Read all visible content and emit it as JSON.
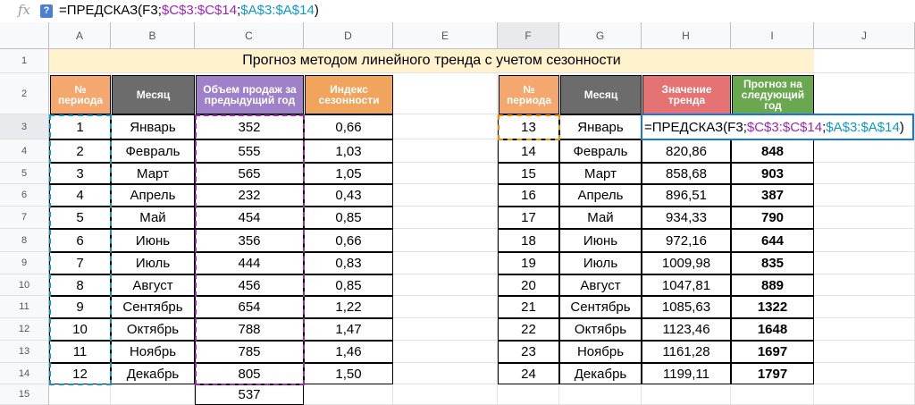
{
  "formula_bar": {
    "icon": "fx-icon",
    "help_icon": "help-icon",
    "help_label": "?",
    "formula": [
      {
        "t": "=ПРЕДСКАЗ(",
        "c": ""
      },
      {
        "t": "F3",
        "c": "f"
      },
      {
        "t": ";",
        "c": ""
      },
      {
        "t": "$C$3:$C$14",
        "c": "ca"
      },
      {
        "t": ";",
        "c": ""
      },
      {
        "t": "$A$3:$A$14",
        "c": "aa"
      },
      {
        "t": ")",
        "c": ""
      }
    ]
  },
  "columns": [
    "A",
    "B",
    "C",
    "D",
    "E",
    "F",
    "G",
    "H",
    "I",
    "J"
  ],
  "row_numbers": [
    "1",
    "2",
    "3",
    "4",
    "5",
    "6",
    "7",
    "8",
    "9",
    "10",
    "11",
    "12",
    "13",
    "14",
    "15"
  ],
  "title": "Прогноз методом линейного тренда с учетом сезонности",
  "left_headers": [
    {
      "text": "№ периода",
      "color": "#f5a86e"
    },
    {
      "text": "Месяц",
      "color": "#6c6c6c"
    },
    {
      "text": "Объем продаж за предыдущий год",
      "color": "#9e81c9"
    },
    {
      "text": "Индекс сезонности",
      "color": "#f0a45c"
    }
  ],
  "right_headers": [
    {
      "text": "№ периода",
      "color": "#f5a86e"
    },
    {
      "text": "Месяц",
      "color": "#6c6c6c"
    },
    {
      "text": "Значение тренда",
      "color": "#e57373"
    },
    {
      "text": "Прогноз на следующий год",
      "color": "#6aa84f"
    }
  ],
  "left_rows": [
    [
      "1",
      "Январь",
      "352",
      "0,66"
    ],
    [
      "2",
      "Февраль",
      "555",
      "1,03"
    ],
    [
      "3",
      "Март",
      "565",
      "1,05"
    ],
    [
      "4",
      "Апрель",
      "232",
      "0,43"
    ],
    [
      "5",
      "Май",
      "454",
      "0,85"
    ],
    [
      "6",
      "Июнь",
      "356",
      "0,66"
    ],
    [
      "7",
      "Июль",
      "444",
      "0,83"
    ],
    [
      "8",
      "Август",
      "456",
      "0,85"
    ],
    [
      "9",
      "Сентябрь",
      "654",
      "1,22"
    ],
    [
      "10",
      "Октябрь",
      "788",
      "1,47"
    ],
    [
      "11",
      "Ноябрь",
      "785",
      "1,46"
    ],
    [
      "12",
      "Декабрь",
      "805",
      "1,50"
    ]
  ],
  "total_c15": "537",
  "right_rows": [
    [
      "13",
      "Январь",
      "",
      ""
    ],
    [
      "14",
      "Февраль",
      "820,86",
      "848"
    ],
    [
      "15",
      "Март",
      "858,68",
      "903"
    ],
    [
      "16",
      "Апрель",
      "896,51",
      "387"
    ],
    [
      "17",
      "Май",
      "934,33",
      "790"
    ],
    [
      "18",
      "Июнь",
      "972,16",
      "644"
    ],
    [
      "19",
      "Июль",
      "1009,98",
      "835"
    ],
    [
      "20",
      "Август",
      "1047,81",
      "889"
    ],
    [
      "21",
      "Сентябрь",
      "1085,63",
      "1322"
    ],
    [
      "22",
      "Октябрь",
      "1123,46",
      "1648"
    ],
    [
      "23",
      "Ноябрь",
      "1161,28",
      "1697"
    ],
    [
      "24",
      "Декабрь",
      "1199,11",
      "1797"
    ]
  ],
  "colors": {
    "title_bg": "#fff2cc",
    "active_border": "#1a73e8",
    "dash_a": "#0f96c6",
    "dash_c": "#9c27b0",
    "dash_f": "#f08c00"
  }
}
